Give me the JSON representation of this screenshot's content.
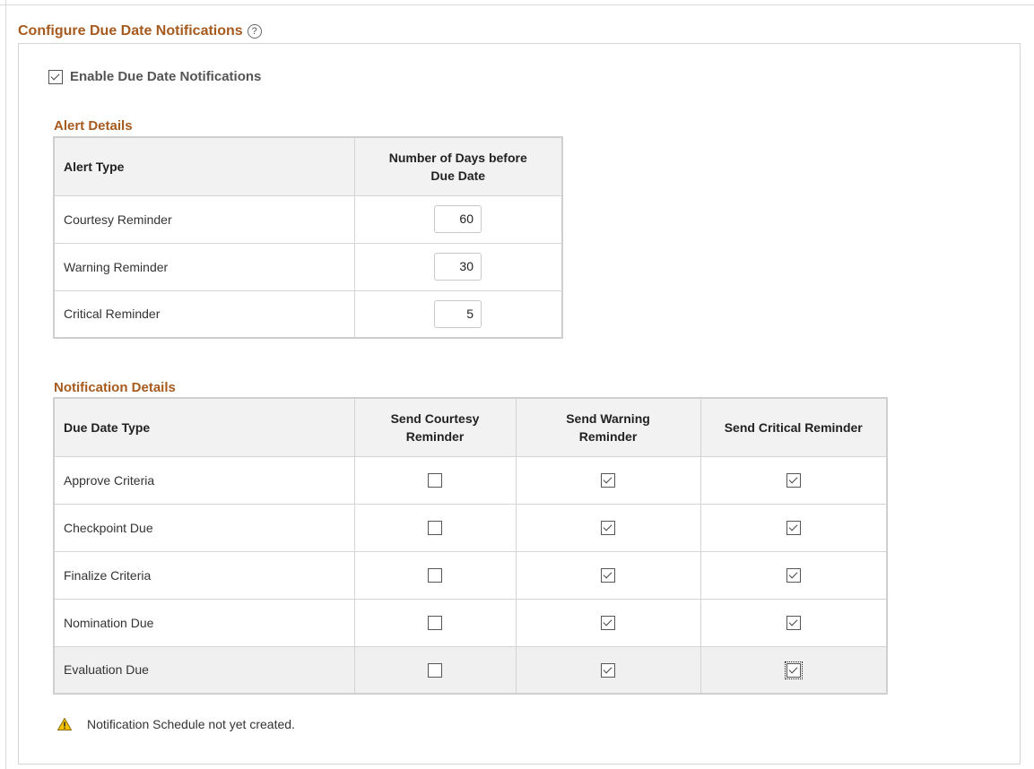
{
  "header": {
    "title": "Configure Due Date Notifications",
    "help_glyph": "?"
  },
  "enable": {
    "label": "Enable Due Date Notifications",
    "checked": true
  },
  "alert_details": {
    "title": "Alert Details",
    "columns": [
      "Alert Type",
      "Number of Days before Due Date"
    ],
    "rows": [
      {
        "type": "Courtesy Reminder",
        "days": "60"
      },
      {
        "type": "Warning Reminder",
        "days": "30"
      },
      {
        "type": "Critical Reminder",
        "days": "5"
      }
    ]
  },
  "notification_details": {
    "title": "Notification Details",
    "columns": [
      "Due Date Type",
      "Send Courtesy Reminder",
      "Send Warning Reminder",
      "Send Critical Reminder"
    ],
    "rows": [
      {
        "type": "Approve Criteria",
        "courtesy": false,
        "warning": true,
        "critical": true
      },
      {
        "type": "Checkpoint Due",
        "courtesy": false,
        "warning": true,
        "critical": true
      },
      {
        "type": "Finalize Criteria",
        "courtesy": false,
        "warning": true,
        "critical": true
      },
      {
        "type": "Nomination Due",
        "courtesy": false,
        "warning": true,
        "critical": true
      },
      {
        "type": "Evaluation Due",
        "courtesy": false,
        "warning": true,
        "critical": true
      }
    ]
  },
  "status": {
    "message": "Notification Schedule not yet created.",
    "icon": "warning-icon",
    "icon_color": "#f2c200"
  },
  "colors": {
    "section_title": "#a75a1e",
    "header_bg": "#f2f2f2",
    "border": "#d4d4d4"
  }
}
